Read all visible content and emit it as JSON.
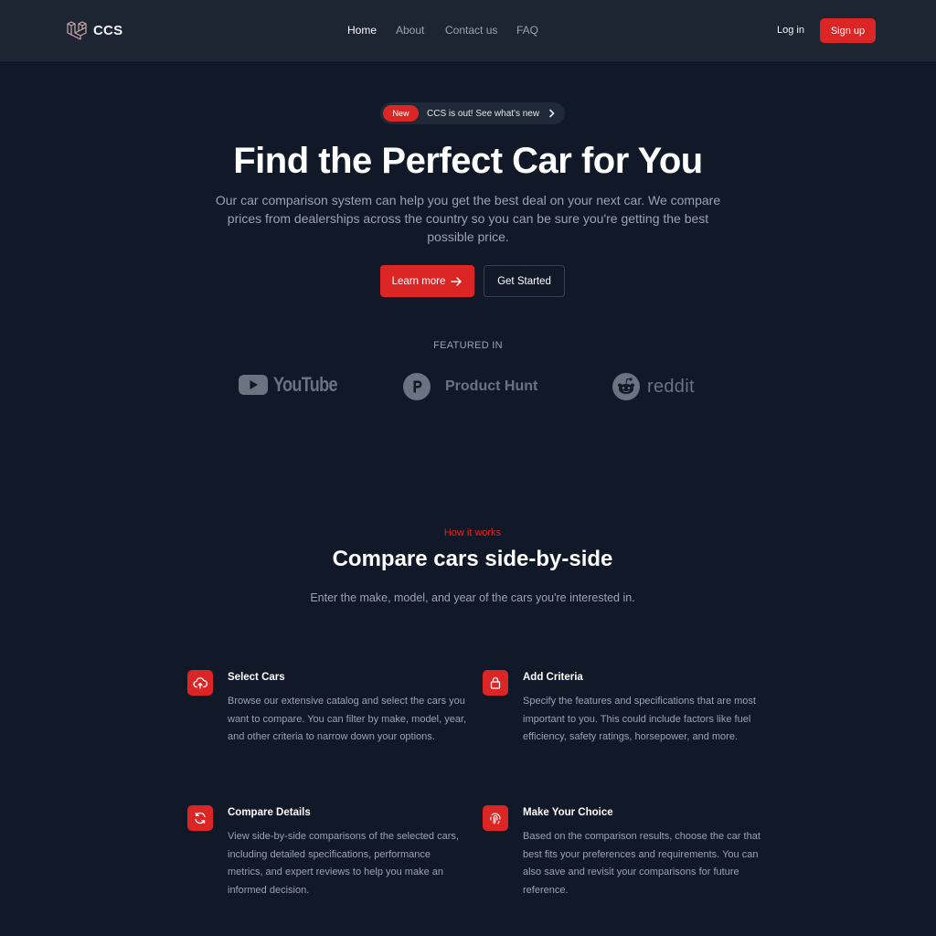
{
  "header": {
    "logo_text": "CCS",
    "nav": [
      {
        "label": "Home",
        "active": true
      },
      {
        "label": "About",
        "active": false
      },
      {
        "label": "Contact us",
        "active": false
      },
      {
        "label": "FAQ",
        "active": false
      }
    ],
    "login_label": "Log in",
    "signup_label": "Sign up"
  },
  "hero": {
    "badge": "New",
    "announcement": "CCS is out! See what's new",
    "title": "Find the Perfect Car for You",
    "description": "Our car comparison system can help you get the best deal on your next car. We compare prices from dealerships across the country so you can be sure you're getting the best possible price.",
    "learn_more_label": "Learn more",
    "get_started_label": "Get Started"
  },
  "featured": {
    "label": "FEATURED IN",
    "brands": [
      {
        "name": "YouTube",
        "icon": "youtube-logo"
      },
      {
        "name": "Product Hunt",
        "icon": "product-hunt-logo"
      },
      {
        "name": "reddit",
        "icon": "reddit-logo"
      }
    ]
  },
  "how": {
    "eyebrow": "How it works",
    "title": "Compare cars side-by-side",
    "subtitle": "Enter the make, model, and year of the cars you're interested in.",
    "features": [
      {
        "icon": "cloud-upload-icon",
        "title": "Select Cars",
        "description": "Browse our extensive catalog and select the cars you want to compare. You can filter by make, model, year, and other criteria to narrow down your options."
      },
      {
        "icon": "lock-icon",
        "title": "Add Criteria",
        "description": "Specify the features and specifications that are most important to you. This could include factors like fuel efficiency, safety ratings, horsepower, and more."
      },
      {
        "icon": "refresh-icon",
        "title": "Compare Details",
        "description": "View side-by-side comparisons of the selected cars, including detailed specifications, performance metrics, and expert reviews to help you make an informed decision."
      },
      {
        "icon": "fingerprint-icon",
        "title": "Make Your Choice",
        "description": "Based on the comparison results, choose the car that best fits your preferences and requirements. You can also save and revisit your comparisons for future reference."
      }
    ]
  },
  "colors": {
    "background": "#111827",
    "header": "#1e2532",
    "accent": "#dc2626",
    "muted_text": "#9ca3af",
    "brand_gray": "#6b7280"
  }
}
